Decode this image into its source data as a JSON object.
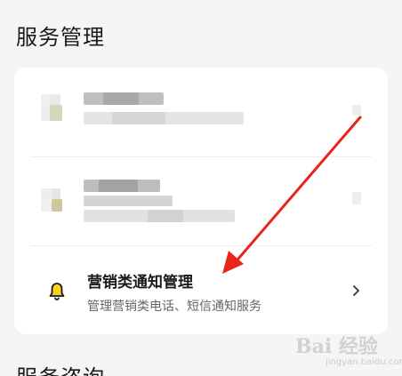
{
  "section": {
    "title": "服务管理",
    "next_title": "服务咨询"
  },
  "notify": {
    "title": "营销类通知管理",
    "subtitle": "管理营销类电话、短信通知服务",
    "icon": "bell-icon",
    "chevron": "chevron-right-icon"
  },
  "watermark": {
    "logo": "Bai 经验",
    "url": "jingyan.baidu.com"
  },
  "colors": {
    "background": "#f5f5f5",
    "card": "#ffffff",
    "arrow": "#e8241c",
    "title": "#1a1a1a",
    "subtitle": "#666666"
  }
}
